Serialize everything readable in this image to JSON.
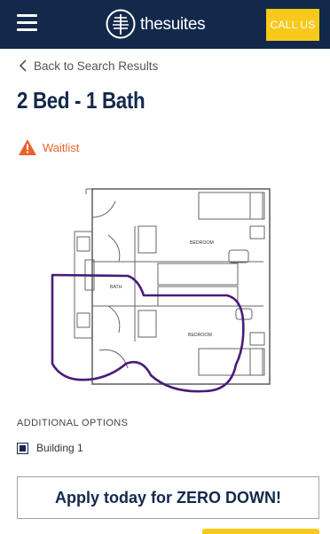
{
  "header": {
    "logo_text": "thesuites",
    "call_label": "CALL US",
    "brand_color": "#13294b",
    "accent_color": "#f7c91b"
  },
  "nav": {
    "back_label": "Back to Search Results"
  },
  "unit": {
    "title": "2 Bed - 1 Bath",
    "status": "Waitlist",
    "status_color": "#e8642a"
  },
  "floorplan": {
    "rooms": [
      "BEDROOM",
      "BATH",
      "BEDROOM"
    ]
  },
  "options": {
    "heading": "ADDITIONAL OPTIONS",
    "items": [
      {
        "label": "Building 1",
        "checked": true
      }
    ]
  },
  "cta": {
    "label": "Apply today for ZERO DOWN!"
  },
  "icons": [
    "menu-icon",
    "logo-icon",
    "chevron-left-icon",
    "warning-icon",
    "checkbox-icon"
  ]
}
